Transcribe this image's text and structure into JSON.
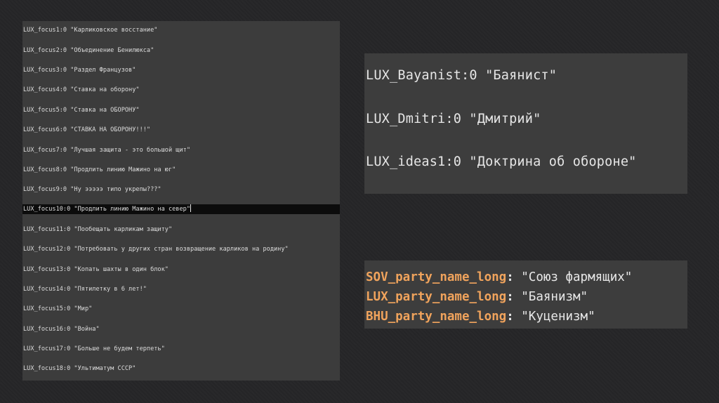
{
  "editor": {
    "lines": [
      "LUX_focus1:0 \"Карликовское восстание\"",
      "LUX_focus2:0 \"Объединение Бенилюкса\"",
      "LUX_focus3:0 \"Раздел Французов\"",
      "LUX_focus4:0 \"Ставка на оборону\"",
      "LUX_focus5:0 \"Ставка на ОБОРОНУ\"",
      "LUX_focus6:0 \"СТАВКА НА ОБОРОНУ!!!\"",
      "LUX_focus7:0 \"Лучшая защита - это большой щит\"",
      "LUX_focus8:0 \"Продлить линию Мажино на юг\"",
      "LUX_focus9:0 \"Ну эээээ типо укрепы???\"",
      "LUX_focus10:0 \"Продлить линию Мажино на север\"",
      "LUX_focus11:0 \"Пообещать карликам защиту\"",
      "LUX_focus12:0 \"Потребовать у других стран возвращение карликов на родину\"",
      "LUX_focus13:0 \"Копать шахты в один блок\"",
      "LUX_focus14:0 \"Пятилетку в 6 лет!\"",
      "LUX_focus15:0 \"Мир\"",
      "LUX_focus16:0 \"Война\"",
      "LUX_focus17:0 \"Больше не будем терпеть\"",
      "LUX_focus18:0 \"Ультиматум СССР\""
    ]
  },
  "panel_top": {
    "entries": [
      "LUX_Bayanist:0 \"Баянист\"",
      "LUX_Dmitri:0 \"Дмитрий\"",
      "LUX_ideas1:0 \"Доктрина об обороне\""
    ]
  },
  "panel_bottom": {
    "entries": [
      {
        "key": "SOV_party_name_long",
        "colon": ":",
        "value": " \"Союз фармящих\""
      },
      {
        "key": "LUX_party_name_long",
        "colon": ":",
        "value": " \"Баянизм\""
      },
      {
        "key": "BHU_party_name_long",
        "colon": ":",
        "value": " \"Куценизм\""
      }
    ]
  },
  "colors": {
    "key": "#f0a35c",
    "editor_bg": "#3c3c3c",
    "current_line_bg": "#0c0c0c"
  }
}
